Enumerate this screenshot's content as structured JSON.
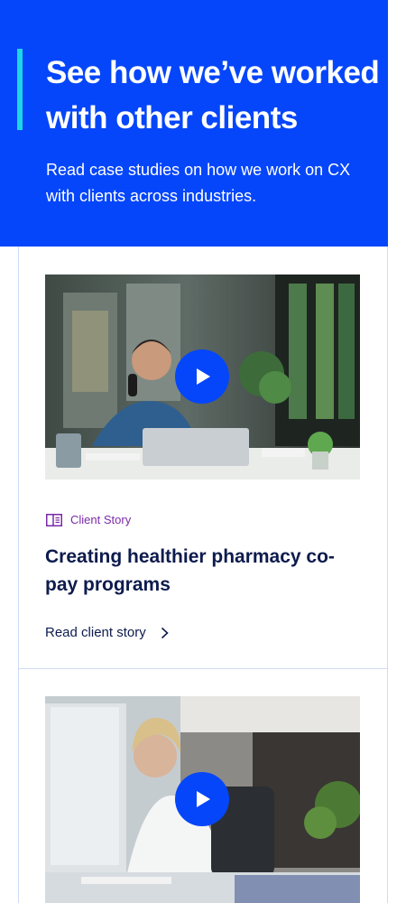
{
  "hero": {
    "title": "See how we’ve worked with other clients",
    "subtitle": "Read case studies on how we work on CX with clients across industries."
  },
  "cards": [
    {
      "image": "man-on-phone-with-laptop-photo",
      "tag": "Client Story",
      "tag_icon": "book-icon",
      "title": "Creating healthier pharmacy co-pay programs",
      "link_label": "Read client story",
      "link_icon": "chevron-right-icon"
    },
    {
      "image": "woman-at-computer-photo"
    }
  ],
  "colors": {
    "brand_blue": "#0546fa",
    "accent_cyan": "#1fd6e6",
    "tag_purple": "#7a2aa8",
    "navy_text": "#0d1b4d",
    "divider": "#cfdcf6"
  }
}
